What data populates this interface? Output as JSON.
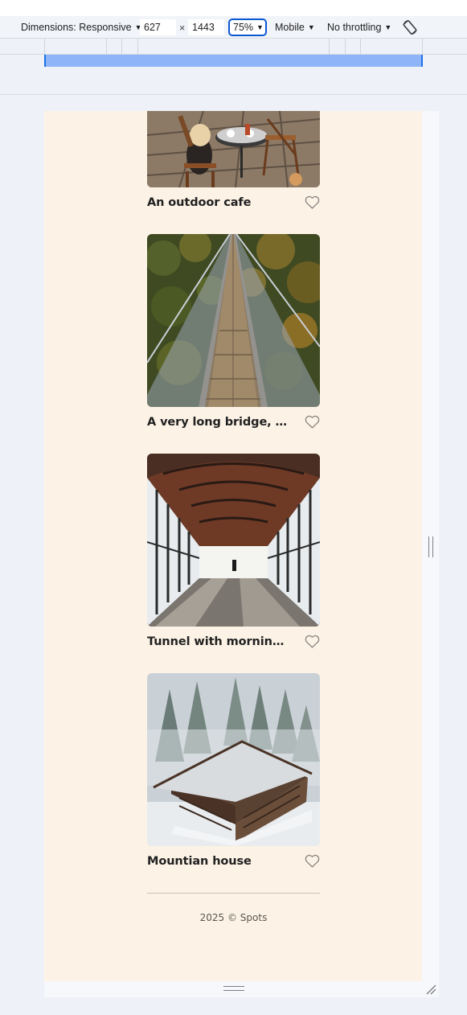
{
  "devtools": {
    "dimensions_label": "Dimensions: Responsive",
    "width_value": "627",
    "times_sign": "×",
    "height_value": "1443",
    "zoom": "75%",
    "device_mode": "Mobile",
    "throttling": "No throttling"
  },
  "icons": {
    "dropdown": "caret-down-icon",
    "rotate": "rotate-icon",
    "like": "heart-outline-icon"
  },
  "cards": [
    {
      "title": "An outdoor cafe"
    },
    {
      "title": "A very long bridge, over the forest and through the trees"
    },
    {
      "title": "Tunnel with morning light"
    },
    {
      "title": "Mountian house"
    }
  ],
  "footer": {
    "copyright": "2025 © Spots"
  },
  "colors": {
    "page_background": "#fcf3e6",
    "devtools_accent": "#0b57d0",
    "media_query_bar": "#8fb4f8",
    "text": "#212121"
  }
}
